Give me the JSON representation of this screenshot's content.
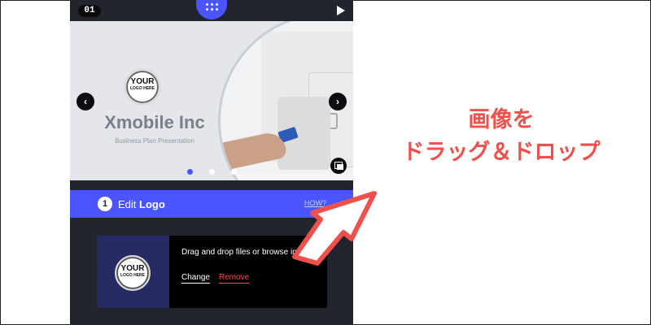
{
  "topbar": {
    "slide_number": "01"
  },
  "preview": {
    "logo_big": "YOUR",
    "logo_small": "LOGO HERE",
    "company_name": "Xmobile Inc",
    "subtitle": "Business Plan Presentation",
    "nav_prev": "‹",
    "nav_next": "›"
  },
  "edit_section": {
    "step": "1",
    "title_prefix": "Edit",
    "title_bold": "Logo",
    "help_link": "HOW?"
  },
  "upload": {
    "thumb_logo_big": "YOUR",
    "thumb_logo_small": "LOGO HERE",
    "instructions": "Drag and drop files or browse images",
    "change_label": "Change",
    "remove_label": "Remove"
  },
  "callout": {
    "line1": "画像を",
    "line2": "ドラッグ＆ドロップ"
  },
  "colors": {
    "accent": "#4a55ff",
    "panel_bg": "#23252e",
    "remove": "#ff4b4b",
    "callout": "#f0504b"
  }
}
